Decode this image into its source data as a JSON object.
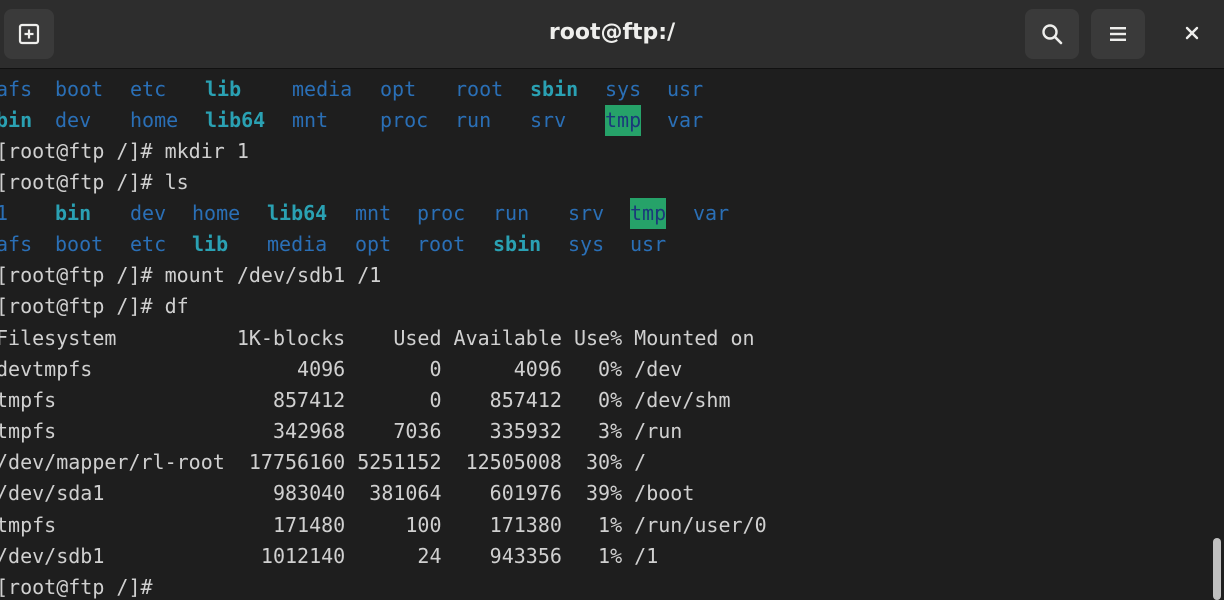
{
  "window": {
    "title": "root@ftp:/"
  },
  "icons": {
    "new_tab": "new-tab-icon",
    "search": "search-icon",
    "menu": "hamburger-menu-icon",
    "close": "close-icon"
  },
  "colors": {
    "dir": "#2a6fb6",
    "link": "#2aa1b3",
    "sticky_bg": "#26a269"
  },
  "terminal": {
    "ls1_row1": [
      "afs",
      "boot",
      "etc",
      "lib",
      "media",
      "opt",
      "root",
      "sbin",
      "sys",
      "usr"
    ],
    "ls1_row2": [
      "bin",
      "dev",
      "home",
      "lib64",
      "mnt",
      "proc",
      "run",
      "srv",
      "tmp",
      "var"
    ],
    "cmd_mkdir": "[root@ftp /]# mkdir 1",
    "cmd_ls": "[root@ftp /]# ls",
    "ls2_row1": [
      "1",
      "bin",
      "dev",
      "home",
      "lib64",
      "mnt",
      "proc",
      "run",
      "srv",
      "tmp",
      "var"
    ],
    "ls2_row2": [
      "afs",
      "boot",
      "etc",
      "lib",
      "media",
      "opt",
      "root",
      "sbin",
      "sys",
      "usr"
    ],
    "cmd_mount": "[root@ftp /]# mount /dev/sdb1 /1",
    "cmd_df": "[root@ftp /]# df",
    "df_header": "Filesystem          1K-blocks    Used Available Use% Mounted on",
    "df_rows": [
      "devtmpfs                 4096       0      4096   0% /dev",
      "tmpfs                  857412       0    857412   0% /dev/shm",
      "tmpfs                  342968    7036    335932   3% /run",
      "/dev/mapper/rl-root  17756160 5251152  12505008  30% /",
      "/dev/sda1              983040  381064    601976  39% /boot",
      "tmpfs                  171480     100    171380   1% /run/user/0",
      "/dev/sdb1             1012140      24    943356   1% /1"
    ],
    "prompt": "[root@ftp /]#"
  }
}
